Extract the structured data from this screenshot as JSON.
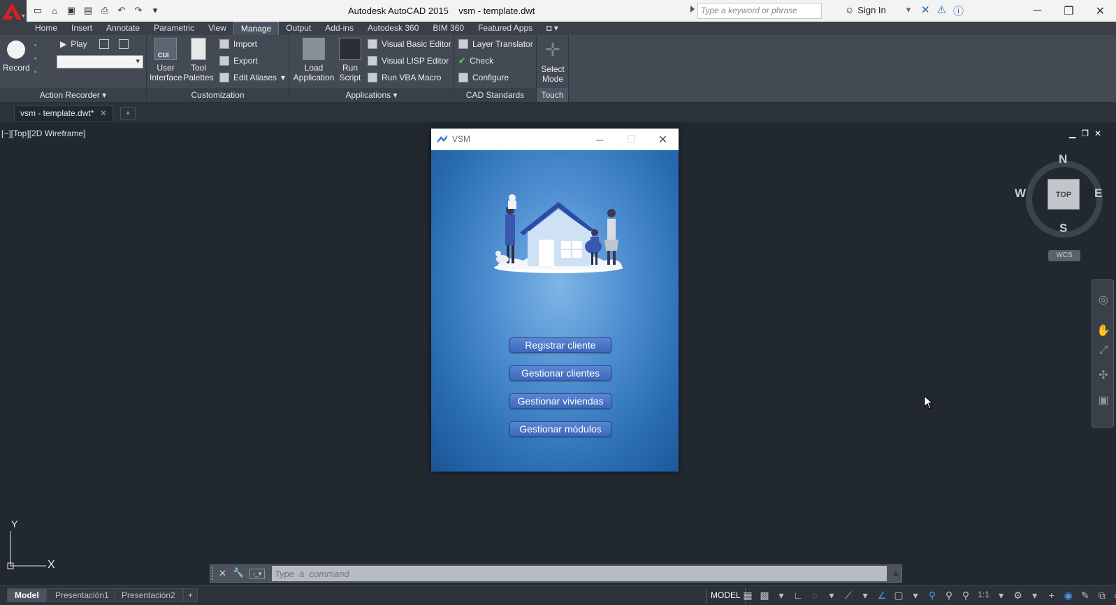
{
  "titlebar": {
    "title": "Autodesk AutoCAD 2015    vsm - template.dwt",
    "search_placeholder": "Type a keyword or phrase",
    "sign_in": "Sign In"
  },
  "ribbon": {
    "tabs": [
      "Home",
      "Insert",
      "Annotate",
      "Parametric",
      "View",
      "Manage",
      "Output",
      "Add-ins",
      "Autodesk 360",
      "BIM 360",
      "Featured Apps"
    ],
    "active_tab": "Manage",
    "action_recorder": {
      "record": "Record",
      "play": "Play",
      "title": "Action Recorder"
    },
    "customization": {
      "user_interface": "User\nInterface",
      "tool_palettes": "Tool\nPalettes",
      "import": "Import",
      "export": "Export",
      "edit_aliases": "Edit Aliases",
      "title": "Customization",
      "cui_badge": "CUI"
    },
    "applications": {
      "load_application": "Load\nApplication",
      "run_script": "Run\nScript",
      "visual_basic_editor": "Visual Basic Editor",
      "visual_lisp_editor": "Visual LISP Editor",
      "run_vba_macro": "Run VBA Macro",
      "title": "Applications"
    },
    "cad_standards": {
      "layer_translator": "Layer Translator",
      "check": "Check",
      "configure": "Configure",
      "title": "CAD Standards"
    },
    "touch": {
      "select_mode": "Select\nMode",
      "title": "Touch"
    }
  },
  "document": {
    "tab_label": "vsm - template.dwt*",
    "viewport_label": "[−][Top][2D Wireframe]"
  },
  "viewcube": {
    "face": "TOP",
    "north": "N",
    "south": "S",
    "east": "E",
    "west": "W",
    "wcs": "WCS"
  },
  "ucs": {
    "x": "X",
    "y": "Y"
  },
  "dialog": {
    "title": "VSM",
    "buttons": [
      "Registrar cliente",
      "Gestionar clientes",
      "Gestionar viviendas",
      "Gestionar módulos"
    ]
  },
  "command_line": {
    "placeholder": "Type  a  command"
  },
  "layout_tabs": [
    "Model",
    "Presentación1",
    "Presentación2"
  ],
  "status": {
    "model": "MODEL",
    "scale": "1:1"
  },
  "colors": {
    "app_background": "#212830",
    "ribbon": "#434a54",
    "dialog_gradient_center": "#7fb4e6",
    "dialog_gradient_edge": "#1a5596",
    "dialog_button": "#4a75c8"
  }
}
